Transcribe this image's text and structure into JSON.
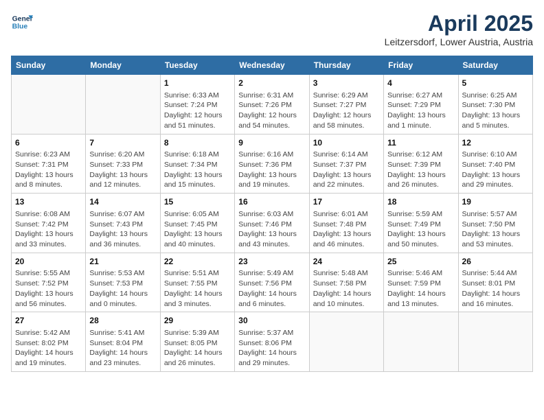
{
  "logo": {
    "line1": "General",
    "line2": "Blue"
  },
  "title": "April 2025",
  "location": "Leitzersdorf, Lower Austria, Austria",
  "headers": [
    "Sunday",
    "Monday",
    "Tuesday",
    "Wednesday",
    "Thursday",
    "Friday",
    "Saturday"
  ],
  "weeks": [
    [
      {
        "day": "",
        "info": ""
      },
      {
        "day": "",
        "info": ""
      },
      {
        "day": "1",
        "info": "Sunrise: 6:33 AM\nSunset: 7:24 PM\nDaylight: 12 hours\nand 51 minutes."
      },
      {
        "day": "2",
        "info": "Sunrise: 6:31 AM\nSunset: 7:26 PM\nDaylight: 12 hours\nand 54 minutes."
      },
      {
        "day": "3",
        "info": "Sunrise: 6:29 AM\nSunset: 7:27 PM\nDaylight: 12 hours\nand 58 minutes."
      },
      {
        "day": "4",
        "info": "Sunrise: 6:27 AM\nSunset: 7:29 PM\nDaylight: 13 hours\nand 1 minute."
      },
      {
        "day": "5",
        "info": "Sunrise: 6:25 AM\nSunset: 7:30 PM\nDaylight: 13 hours\nand 5 minutes."
      }
    ],
    [
      {
        "day": "6",
        "info": "Sunrise: 6:23 AM\nSunset: 7:31 PM\nDaylight: 13 hours\nand 8 minutes."
      },
      {
        "day": "7",
        "info": "Sunrise: 6:20 AM\nSunset: 7:33 PM\nDaylight: 13 hours\nand 12 minutes."
      },
      {
        "day": "8",
        "info": "Sunrise: 6:18 AM\nSunset: 7:34 PM\nDaylight: 13 hours\nand 15 minutes."
      },
      {
        "day": "9",
        "info": "Sunrise: 6:16 AM\nSunset: 7:36 PM\nDaylight: 13 hours\nand 19 minutes."
      },
      {
        "day": "10",
        "info": "Sunrise: 6:14 AM\nSunset: 7:37 PM\nDaylight: 13 hours\nand 22 minutes."
      },
      {
        "day": "11",
        "info": "Sunrise: 6:12 AM\nSunset: 7:39 PM\nDaylight: 13 hours\nand 26 minutes."
      },
      {
        "day": "12",
        "info": "Sunrise: 6:10 AM\nSunset: 7:40 PM\nDaylight: 13 hours\nand 29 minutes."
      }
    ],
    [
      {
        "day": "13",
        "info": "Sunrise: 6:08 AM\nSunset: 7:42 PM\nDaylight: 13 hours\nand 33 minutes."
      },
      {
        "day": "14",
        "info": "Sunrise: 6:07 AM\nSunset: 7:43 PM\nDaylight: 13 hours\nand 36 minutes."
      },
      {
        "day": "15",
        "info": "Sunrise: 6:05 AM\nSunset: 7:45 PM\nDaylight: 13 hours\nand 40 minutes."
      },
      {
        "day": "16",
        "info": "Sunrise: 6:03 AM\nSunset: 7:46 PM\nDaylight: 13 hours\nand 43 minutes."
      },
      {
        "day": "17",
        "info": "Sunrise: 6:01 AM\nSunset: 7:48 PM\nDaylight: 13 hours\nand 46 minutes."
      },
      {
        "day": "18",
        "info": "Sunrise: 5:59 AM\nSunset: 7:49 PM\nDaylight: 13 hours\nand 50 minutes."
      },
      {
        "day": "19",
        "info": "Sunrise: 5:57 AM\nSunset: 7:50 PM\nDaylight: 13 hours\nand 53 minutes."
      }
    ],
    [
      {
        "day": "20",
        "info": "Sunrise: 5:55 AM\nSunset: 7:52 PM\nDaylight: 13 hours\nand 56 minutes."
      },
      {
        "day": "21",
        "info": "Sunrise: 5:53 AM\nSunset: 7:53 PM\nDaylight: 14 hours\nand 0 minutes."
      },
      {
        "day": "22",
        "info": "Sunrise: 5:51 AM\nSunset: 7:55 PM\nDaylight: 14 hours\nand 3 minutes."
      },
      {
        "day": "23",
        "info": "Sunrise: 5:49 AM\nSunset: 7:56 PM\nDaylight: 14 hours\nand 6 minutes."
      },
      {
        "day": "24",
        "info": "Sunrise: 5:48 AM\nSunset: 7:58 PM\nDaylight: 14 hours\nand 10 minutes."
      },
      {
        "day": "25",
        "info": "Sunrise: 5:46 AM\nSunset: 7:59 PM\nDaylight: 14 hours\nand 13 minutes."
      },
      {
        "day": "26",
        "info": "Sunrise: 5:44 AM\nSunset: 8:01 PM\nDaylight: 14 hours\nand 16 minutes."
      }
    ],
    [
      {
        "day": "27",
        "info": "Sunrise: 5:42 AM\nSunset: 8:02 PM\nDaylight: 14 hours\nand 19 minutes."
      },
      {
        "day": "28",
        "info": "Sunrise: 5:41 AM\nSunset: 8:04 PM\nDaylight: 14 hours\nand 23 minutes."
      },
      {
        "day": "29",
        "info": "Sunrise: 5:39 AM\nSunset: 8:05 PM\nDaylight: 14 hours\nand 26 minutes."
      },
      {
        "day": "30",
        "info": "Sunrise: 5:37 AM\nSunset: 8:06 PM\nDaylight: 14 hours\nand 29 minutes."
      },
      {
        "day": "",
        "info": ""
      },
      {
        "day": "",
        "info": ""
      },
      {
        "day": "",
        "info": ""
      }
    ]
  ]
}
